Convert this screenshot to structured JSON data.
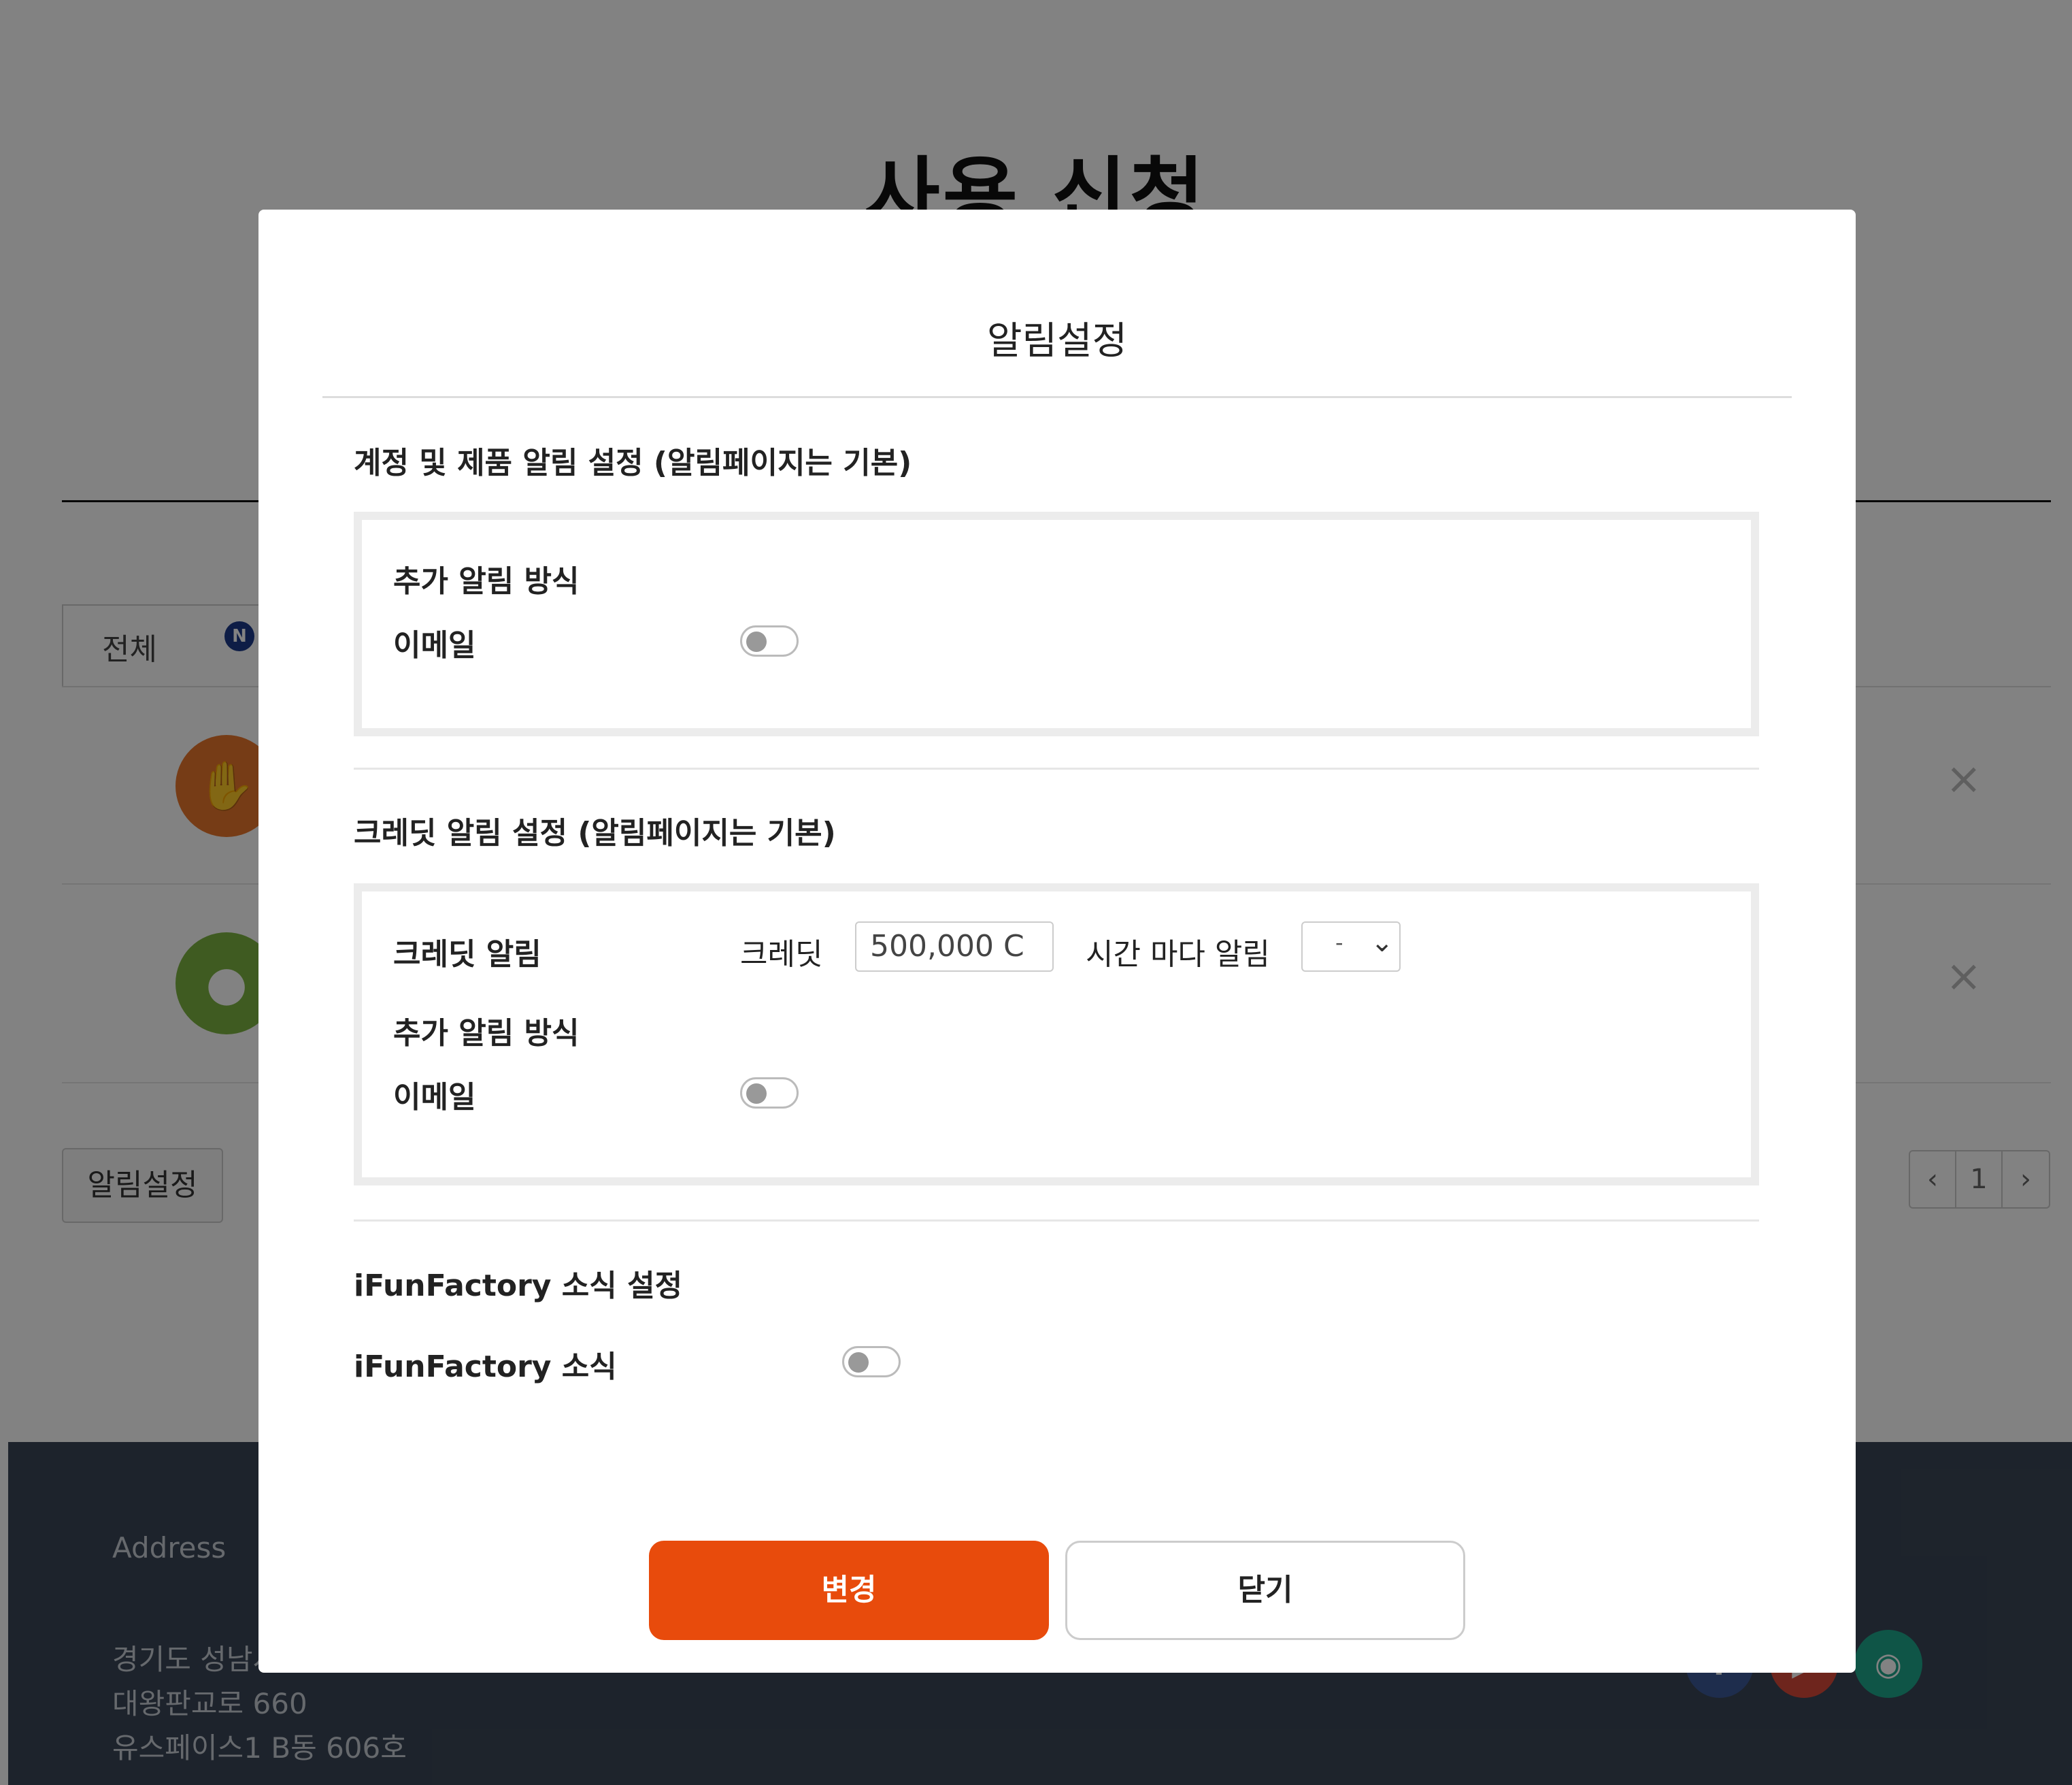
{
  "background": {
    "page_title": "사용 신청",
    "tab_all": "전체",
    "tab_badge": "N",
    "row_close_icon": "×",
    "alarm_settings_button": "알림설정",
    "pagination": {
      "prev": "‹",
      "current": "1",
      "next": "›"
    },
    "footer": {
      "address_label": "Address",
      "address_lines": [
        "경기도 성남시",
        "대왕판교로 660",
        "유스페이스1 B동 606호"
      ]
    },
    "social": [
      "facebook-icon",
      "youtube-icon",
      "github-icon"
    ]
  },
  "modal": {
    "title": "알림설정",
    "account_section": {
      "title": "계정 및 제품 알림 설정 (알림페이지는 기본)",
      "extra_method_label": "추가 알림 방식",
      "email_label": "이메일",
      "email_enabled": false
    },
    "credit_section": {
      "title": "크레딧 알림 설정 (알림페이지는 기본)",
      "credit_alert_label": "크레딧 알림",
      "credit_label": "크레딧",
      "credit_value": "500,000 C",
      "hours_label": "시간 마다 알림",
      "hours_select_value": "-",
      "extra_method_label": "추가 알림 방식",
      "email_label": "이메일",
      "email_enabled": false
    },
    "news_section": {
      "title": "iFunFactory 소식 설정",
      "news_label": "iFunFactory 소식",
      "news_enabled": false
    },
    "buttons": {
      "submit": "변경",
      "close": "닫기"
    }
  },
  "colors": {
    "primary": "#e84b0c",
    "overlay": "rgba(0,0,0,0.49)",
    "footer_bg": "#3a4656",
    "badge": "#1d3a8a"
  }
}
